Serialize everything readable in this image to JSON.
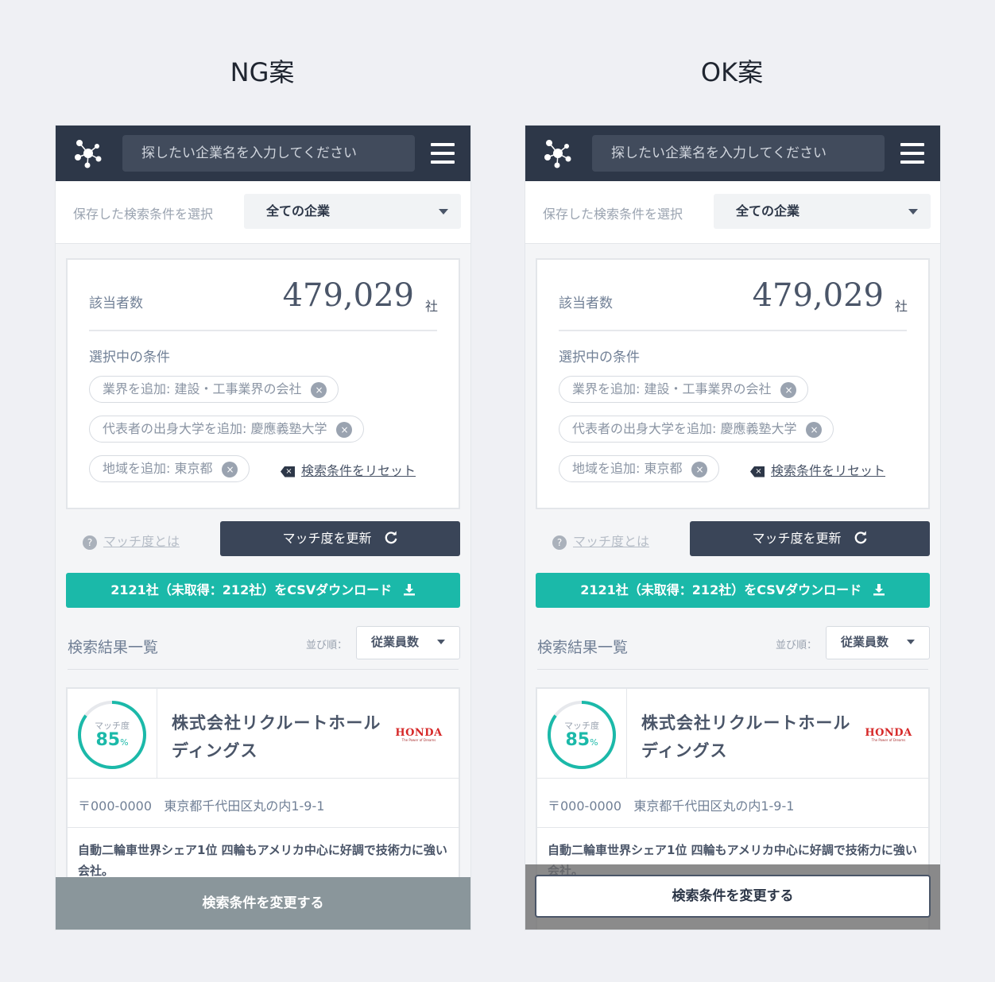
{
  "variants": [
    {
      "title": "NG案"
    },
    {
      "title": "OK案"
    }
  ],
  "header": {
    "search_placeholder": "探したい企業名を入力してください"
  },
  "saved": {
    "label": "保存した検索条件を選択",
    "selected": "全ての企業"
  },
  "summary": {
    "count_label": "該当者数",
    "count": "479,029",
    "unit": "社",
    "conditions_label": "選択中の条件",
    "tags": [
      "業界を追加: 建設・工事業界の会社",
      "代表者の出身大学を追加: 慶應義塾大学",
      "地域を追加: 東京都"
    ],
    "tag_remove": "×",
    "reset_label": "検索条件をリセット"
  },
  "actions": {
    "help_q": "?",
    "help_link": "マッチ度とは",
    "update_label": "マッチ度を更新",
    "update_icon": "refresh-icon",
    "csv_label": "2121社（未取得：212社）をCSVダウンロード",
    "csv_icon": "download-icon"
  },
  "results": {
    "title": "検索結果一覧",
    "sort_label": "並び順：",
    "sort_value": "従業員数"
  },
  "company": {
    "match_label": "マッチ度",
    "match_value": "85",
    "match_percent": 0.85,
    "match_unit": "%",
    "name": "株式会社リクルートホールディングス",
    "logo_text": "HONDA",
    "logo_sub": "The Power of Dreams",
    "postal": "〒000-0000",
    "address": "東京都千代田区丸の内1-9-1",
    "description": "自動二輪車世界シェア1位 四輪もアメリカ中心に好調で技術力に強い会社。"
  },
  "footer": {
    "change_label": "検索条件を変更する"
  },
  "colors": {
    "topbar": "#2d3748",
    "accent": "#1bb9a9",
    "ng_footer": "#8a969b"
  }
}
